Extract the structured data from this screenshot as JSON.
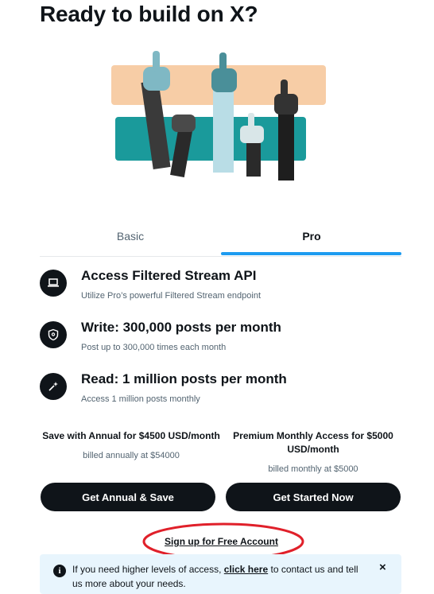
{
  "heading": "Ready to build on X?",
  "tabs": [
    {
      "label": "Basic",
      "active": false
    },
    {
      "label": "Pro",
      "active": true
    }
  ],
  "features": [
    {
      "title": "Access Filtered Stream API",
      "desc": "Utilize Pro’s powerful Filtered Stream endpoint",
      "icon": "laptop-icon"
    },
    {
      "title": "Write: 300,000 posts per month",
      "desc": "Post up to 300,000 times each month",
      "icon": "shield-icon"
    },
    {
      "title": "Read: 1 million posts per month",
      "desc": "Access 1 million posts monthly",
      "icon": "sparkle-icon"
    }
  ],
  "plans": [
    {
      "title": "Save with Annual for $4500 USD/month",
      "billing": "billed annually at $54000",
      "button": "Get Annual & Save"
    },
    {
      "title": "Premium Monthly Access for $5000 USD/month",
      "billing": "billed monthly at $5000",
      "button": "Get Started Now"
    }
  ],
  "free_link": "Sign up for Free Account",
  "banner": {
    "text_before": "If you need higher levels of access, ",
    "link": "click here",
    "text_after": " to contact us and tell us more about your needs.",
    "close": "×"
  },
  "colors": {
    "accent": "#1d9bf0",
    "dark": "#0f1419",
    "banner_bg": "#e8f5fd",
    "highlight": "#e0202a"
  }
}
